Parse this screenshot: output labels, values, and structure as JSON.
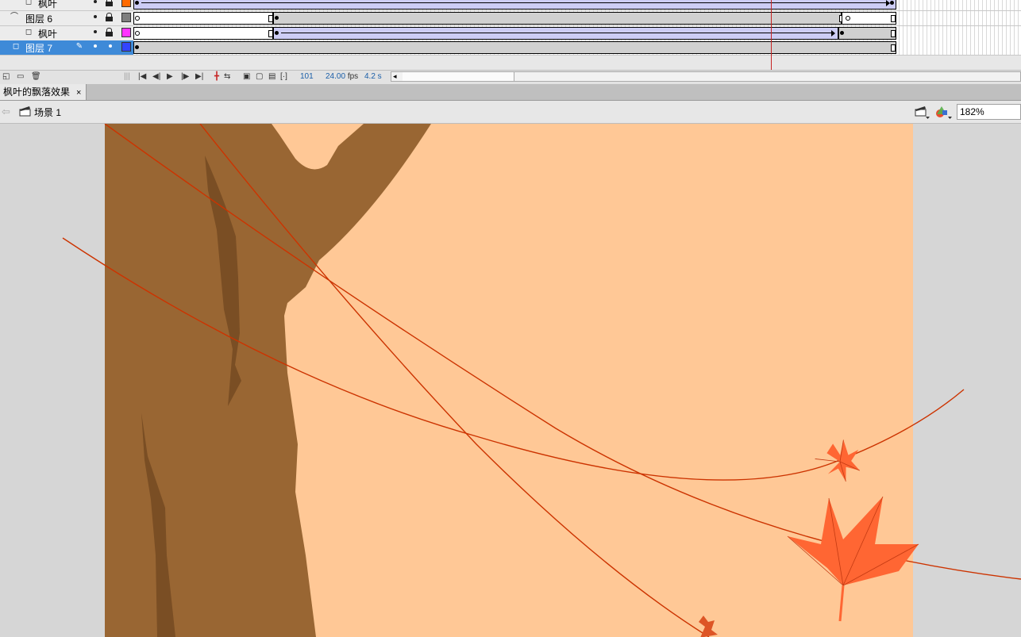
{
  "timeline": {
    "layers": [
      {
        "name": "枫叶",
        "type": "normal",
        "color": "#ff6a00",
        "indent": true
      },
      {
        "name": "图层 6",
        "type": "guide",
        "color": "#7f7f7f",
        "indent": false
      },
      {
        "name": "枫叶",
        "type": "normal",
        "color": "#ff33ff",
        "indent": true
      },
      {
        "name": "图层 7",
        "type": "normal",
        "color": "#3344ff",
        "indent": false,
        "selected": true
      }
    ],
    "current_frame": "101",
    "frame_rate": "24.00",
    "frame_rate_unit": "fps",
    "elapsed_time": "4.2 s"
  },
  "document": {
    "tab_title": "枫叶的飘落效果",
    "close_glyph": "×"
  },
  "edit_bar": {
    "scene_label": "场景 1",
    "zoom": "182%"
  },
  "colors": {
    "stage_bg": "#ffc896",
    "trunk": "#996633",
    "trunk_shadow": "#7a4e24",
    "guide_path": "#cc3300",
    "leaf": "#ff6633",
    "leaf_vein": "#c43a12",
    "playhead": "#c62424"
  },
  "icons": [
    "new-layer-icon",
    "new-folder-icon",
    "delete-icon",
    "first-frame-icon",
    "prev-frame-icon",
    "play-icon",
    "next-frame-icon",
    "last-frame-icon",
    "center-frame-icon",
    "loop-icon",
    "onion-skin-icon",
    "onion-outline-icon",
    "edit-multiple-icon",
    "modify-markers-icon",
    "back-arrow-icon",
    "scene-icon",
    "edit-scene-icon",
    "edit-symbol-icon"
  ]
}
